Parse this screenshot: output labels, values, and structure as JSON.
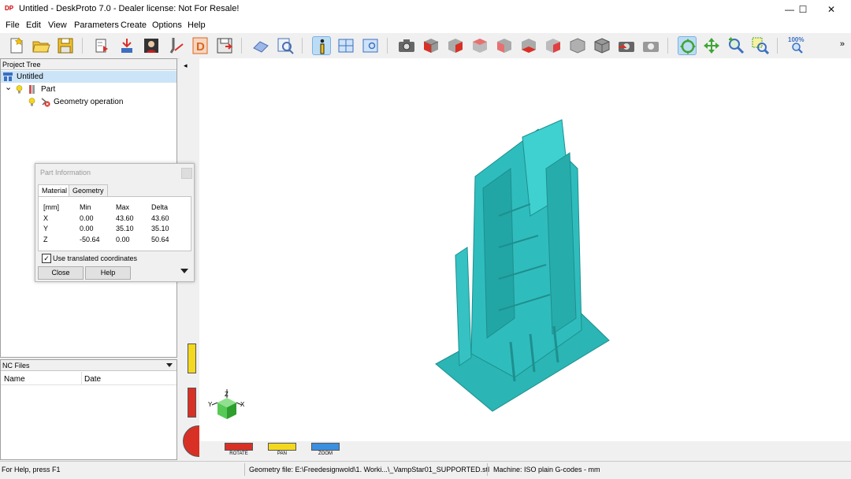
{
  "window": {
    "app_logo_text": "DP",
    "title": "Untitled - DeskProto 7.0 - Dealer license: Not For Resale!",
    "minimize_glyph": "—",
    "maximize_glyph": "☐",
    "close_glyph": "✕"
  },
  "menu": [
    "File",
    "Edit",
    "View",
    "Parameters",
    "Create",
    "Options",
    "Help"
  ],
  "toolbar": {
    "more_glyph": "»",
    "zoom_100_label": "100%"
  },
  "project_tree": {
    "header": "Project Tree",
    "items": [
      {
        "label": "Untitled",
        "icon": "project-icon"
      },
      {
        "label": "Part",
        "icon": "part-icon",
        "expand_glyph": "⌄"
      },
      {
        "label": "Geometry operation",
        "icon": "geometry-operation-icon"
      }
    ]
  },
  "nc_files": {
    "header": "NC Files",
    "columns": [
      "Name",
      "Date"
    ]
  },
  "part_information": {
    "title": "Part Information",
    "tabs": [
      "Material",
      "Geometry"
    ],
    "active_tab": "Material",
    "table": {
      "headers": [
        "[mm]",
        "Min",
        "Max",
        "Delta"
      ],
      "rows": [
        [
          "X",
          "0.00",
          "43.60",
          "43.60"
        ],
        [
          "Y",
          "0.00",
          "35.10",
          "35.10"
        ],
        [
          "Z",
          "-50.64",
          "0.00",
          "50.64"
        ]
      ]
    },
    "use_translated_coordinates": {
      "label": "Use translated coordinates",
      "checked": true,
      "glyph": "✓"
    },
    "buttons": {
      "close": "Close",
      "help": "Help"
    }
  },
  "view": {
    "axes": {
      "x": "X",
      "y": "Y",
      "z": "Z"
    },
    "model_color": "#2bb5b5",
    "dials": {
      "rotate": "ROTATE",
      "pan": "PAN",
      "zoom": "ZOOM"
    },
    "collapse_glyph": "◂"
  },
  "statusbar": {
    "help": "For Help, press F1",
    "geometry_file": "Geometry file: E:\\Freedesignwold\\1. Worki...\\_VampStar01_SUPPORTED.stl",
    "machine": "Machine: ISO plain G-codes - mm"
  }
}
